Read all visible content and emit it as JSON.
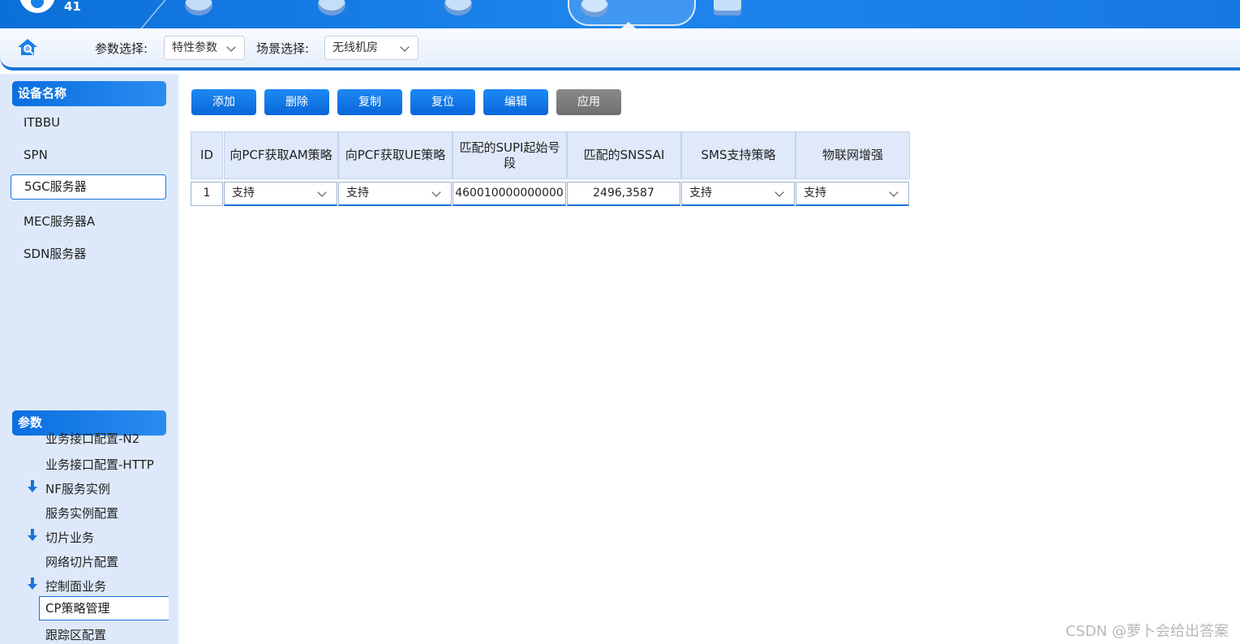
{
  "header": {
    "user_number": "41",
    "active_tab_icon": "network-config-icon"
  },
  "toolbar": {
    "param_label": "参数选择:",
    "param_value": "特性参数",
    "scene_label": "场景选择:",
    "scene_value": "无线机房"
  },
  "sidebar": {
    "devices_title": "设备名称",
    "devices": [
      "ITBBU",
      "SPN",
      "5GC服务器",
      "MEC服务器A",
      "SDN服务器"
    ],
    "selected_device": "5GC服务器",
    "params_title": "参数",
    "params": [
      {
        "label": "业务接口配置-N2",
        "expandable": false
      },
      {
        "label": "业务接口配置-HTTP",
        "expandable": false
      },
      {
        "label": "NF服务实例",
        "expandable": true
      },
      {
        "label": "服务实例配置",
        "expandable": false
      },
      {
        "label": "切片业务",
        "expandable": true
      },
      {
        "label": "网络切片配置",
        "expandable": false
      },
      {
        "label": "控制面业务",
        "expandable": true
      },
      {
        "label": "CP策略管理",
        "expandable": false
      },
      {
        "label": "跟踪区配置",
        "expandable": false
      }
    ],
    "selected_param": "CP策略管理"
  },
  "actions": [
    "添加",
    "删除",
    "复制",
    "复位",
    "编辑",
    "应用"
  ],
  "table": {
    "headers": [
      "ID",
      "向PCF获取AM策略",
      "向PCF获取UE策略",
      "匹配的SUPI起始号段",
      "匹配的SNSSAI",
      "SMS支持策略",
      "物联网增强"
    ],
    "rows": [
      [
        "1",
        "支持",
        "支持",
        "460010000000000",
        "2496,3587",
        "支持",
        "支持"
      ]
    ]
  },
  "watermark": "CSDN @萝卜会给出答案",
  "colors": {
    "primary": "#0a6fe0",
    "panel": "#dde9fa",
    "header_cell": "#dfe9fa",
    "disabled_button": "#777777"
  }
}
